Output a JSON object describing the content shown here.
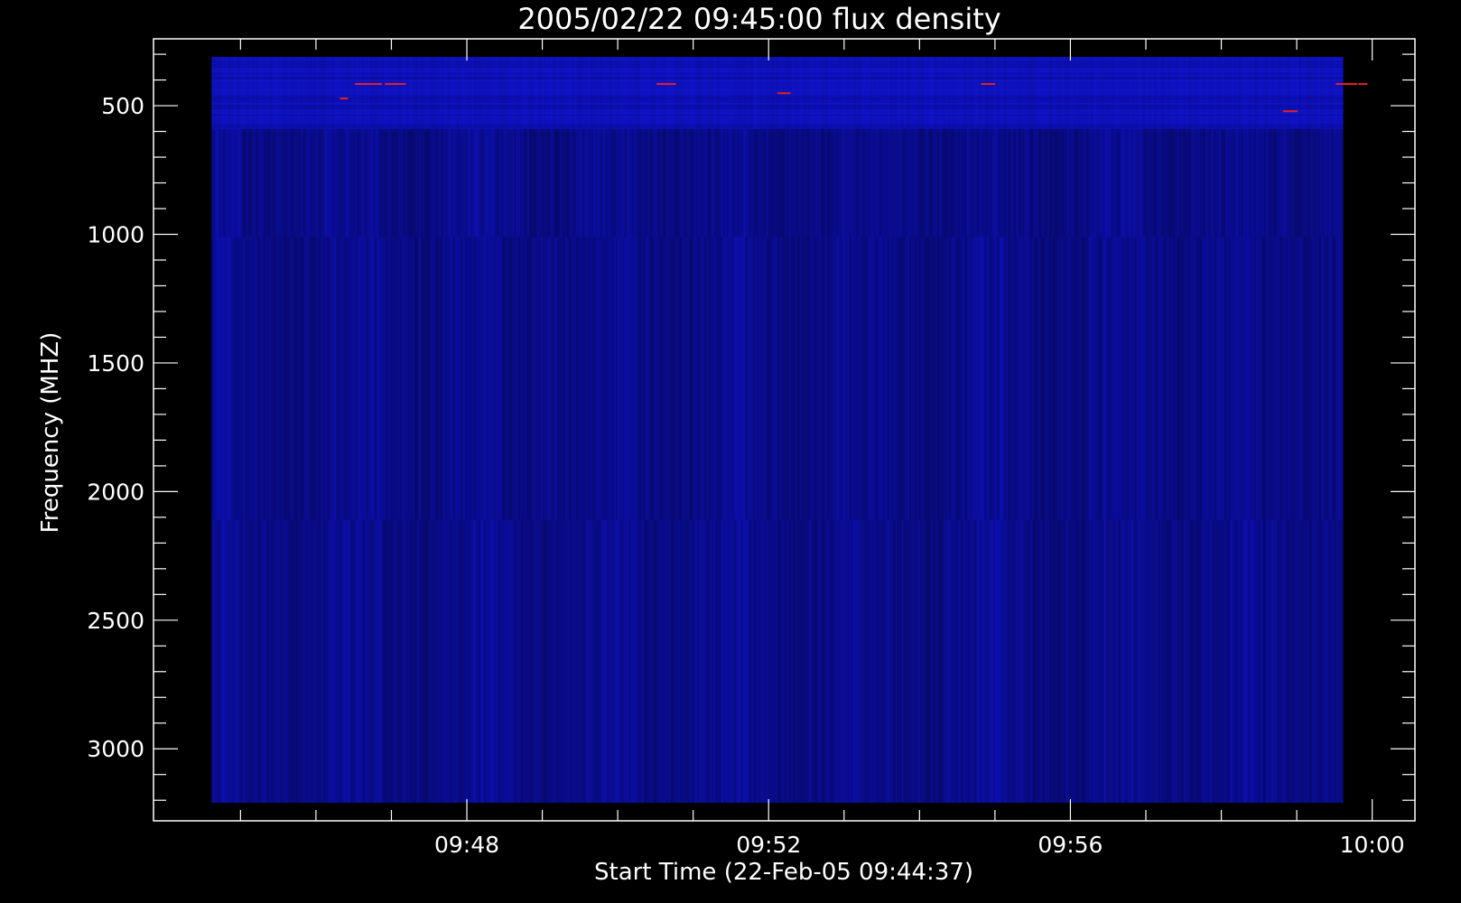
{
  "chart_data": {
    "type": "heatmap",
    "title": "2005/02/22 09:45:00 flux density",
    "xlabel": "Start Time (22-Feb-05 09:44:37)",
    "ylabel": "Frequency (MHZ)",
    "x_tick_labels": [
      "09:48",
      "09:52",
      "09:56",
      "10:00"
    ],
    "x_tick_values_min": [
      3.3833,
      7.3833,
      11.3833,
      15.3833
    ],
    "x_range_min": [
      -0.77,
      15.95
    ],
    "data_x_range_min": [
      0,
      15.0
    ],
    "y_tick_labels": [
      "500",
      "1000",
      "1500",
      "2000",
      "2500",
      "3000"
    ],
    "y_tick_values": [
      500,
      1000,
      1500,
      2000,
      2500,
      3000
    ],
    "y_range": [
      240,
      3280
    ],
    "data_y_range": [
      310,
      3210
    ],
    "y_inverted": true,
    "frequency_bands_mhz": [
      [
        310,
        590
      ],
      [
        590,
        1010
      ],
      [
        1010,
        2110
      ],
      [
        2110,
        3210
      ]
    ],
    "colors": {
      "background": "#000000",
      "axes": "#ffffff",
      "base": "#0f12c4",
      "dark": "#07096e",
      "burst": "#e02020"
    }
  }
}
